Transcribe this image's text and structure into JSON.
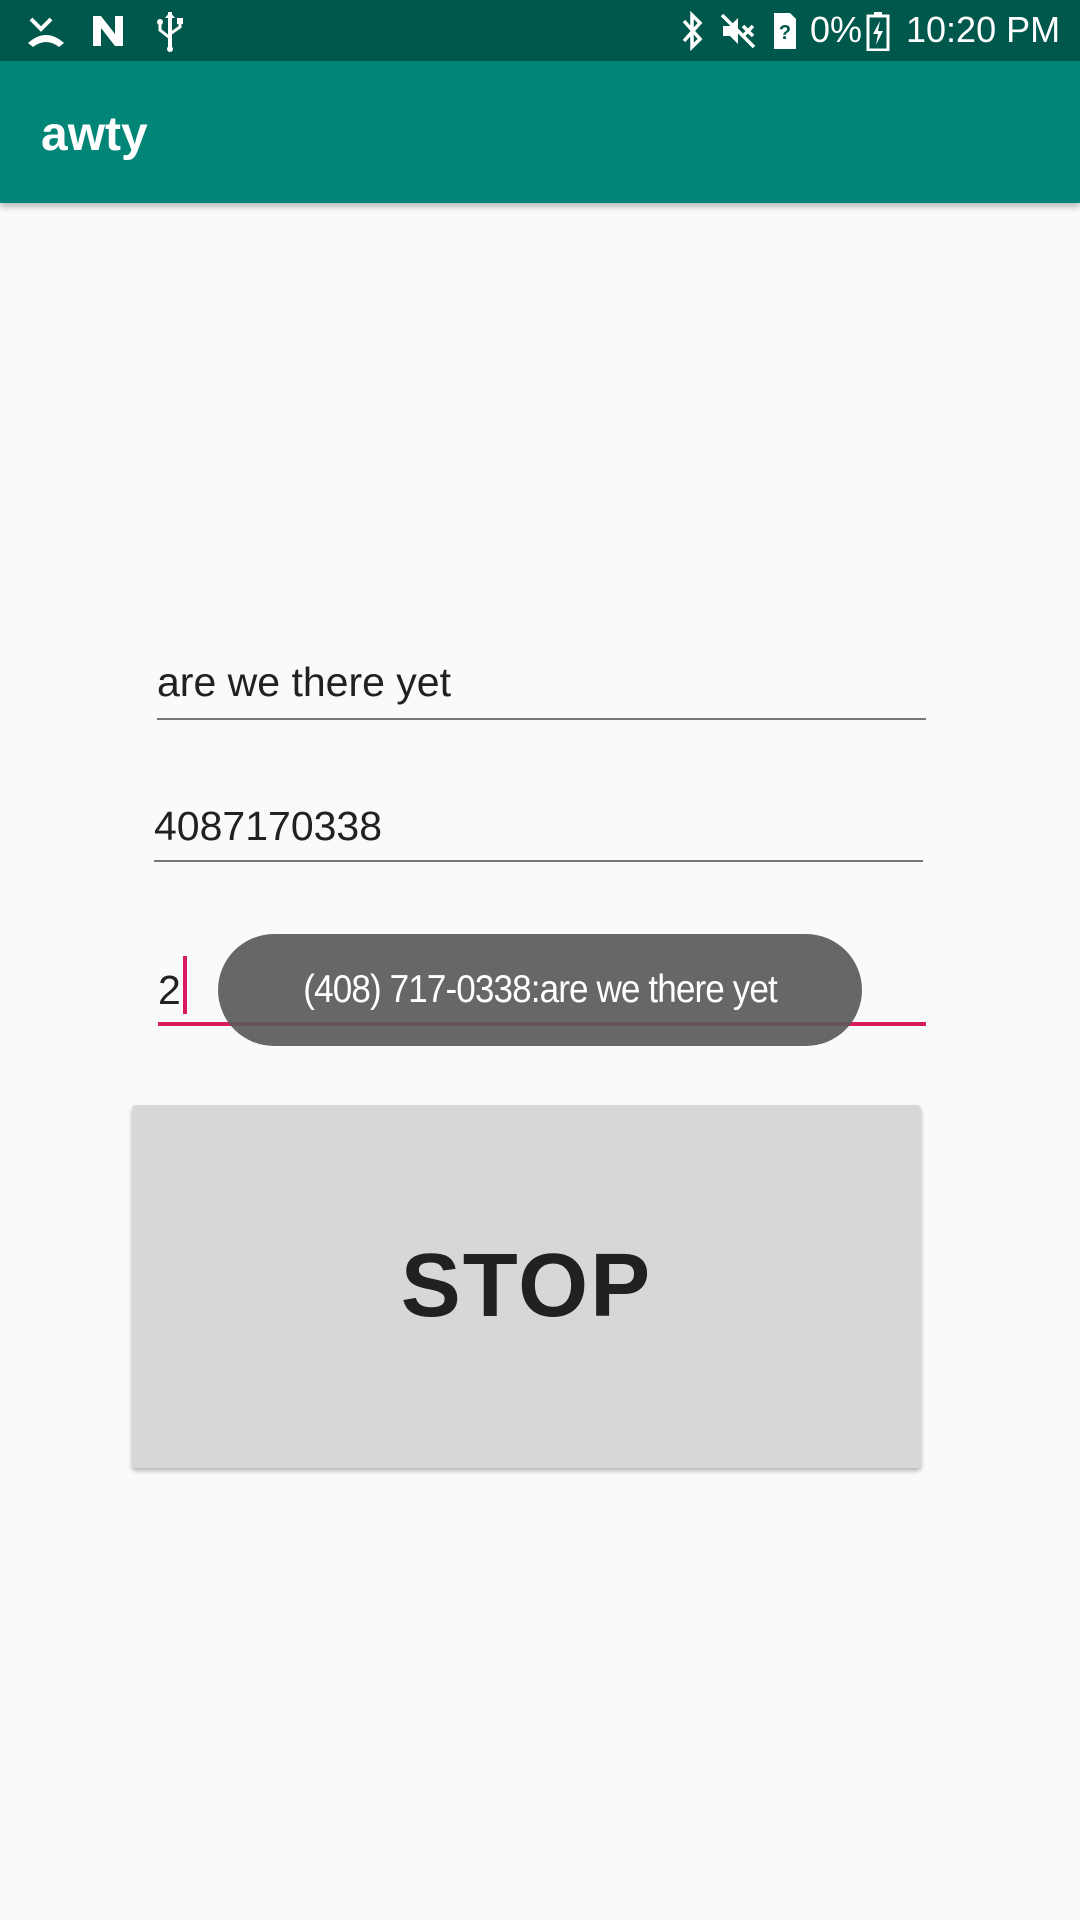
{
  "status_bar": {
    "left_icons": [
      "missed-call-icon",
      "n-notification-icon",
      "usb-icon"
    ],
    "right_icons": [
      "bluetooth-icon",
      "mute-icon",
      "sim-unknown-icon",
      "battery-charging-icon"
    ],
    "battery_text": "0%",
    "time": "10:20 PM"
  },
  "app_bar": {
    "title": "awty"
  },
  "form": {
    "message_value": "are we there yet",
    "phone_value": "4087170338",
    "interval_value": "2"
  },
  "stop_button": {
    "label": "STOP"
  },
  "toast": {
    "text": "(408) 717-0338:are we there yet"
  },
  "colors": {
    "status_bar": "#00574b",
    "app_bar": "#008577",
    "accent": "#d81b60",
    "button": "#d6d7d7",
    "background": "#fafafa"
  }
}
